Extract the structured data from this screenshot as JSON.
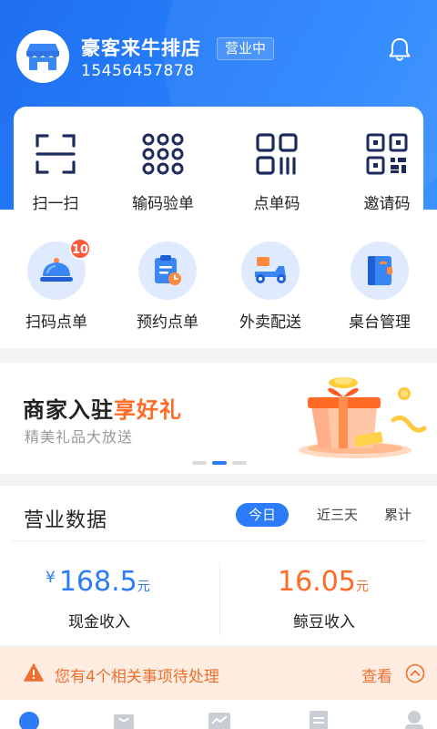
{
  "header": {
    "store_name": "豪客来牛排店",
    "status": "营业中",
    "phone": "15456457878"
  },
  "tools": [
    {
      "label": "扫一扫",
      "icon": "scan-icon"
    },
    {
      "label": "输码验单",
      "icon": "code-verify-icon"
    },
    {
      "label": "点单码",
      "icon": "order-code-icon"
    },
    {
      "label": "邀请码",
      "icon": "qr-code-icon"
    }
  ],
  "services": [
    {
      "label": "扫码点单",
      "icon": "food-cloche-icon",
      "badge": "10"
    },
    {
      "label": "预约点单",
      "icon": "clipboard-clock-icon"
    },
    {
      "label": "外卖配送",
      "icon": "delivery-scooter-icon"
    },
    {
      "label": "桌台管理",
      "icon": "table-book-icon"
    }
  ],
  "banner": {
    "title_prefix": "商家入驻",
    "title_highlight": "享好礼",
    "subtitle": "精美礼品大放送"
  },
  "business_data": {
    "title": "营业数据",
    "tabs": [
      "今日",
      "近三天",
      "累计"
    ],
    "active_tab": "今日",
    "cash": {
      "currency": "¥",
      "value": "168.5",
      "unit": "元",
      "label": "现金收入"
    },
    "beans": {
      "value": "16.05",
      "unit": "元",
      "label": "鲸豆收入"
    }
  },
  "notice": {
    "text": "您有4个相关事项待处理",
    "action": "查看"
  },
  "colors": {
    "primary": "#2a7bf5",
    "orange": "#ff6a25",
    "notice_bg": "#fdecdf"
  }
}
